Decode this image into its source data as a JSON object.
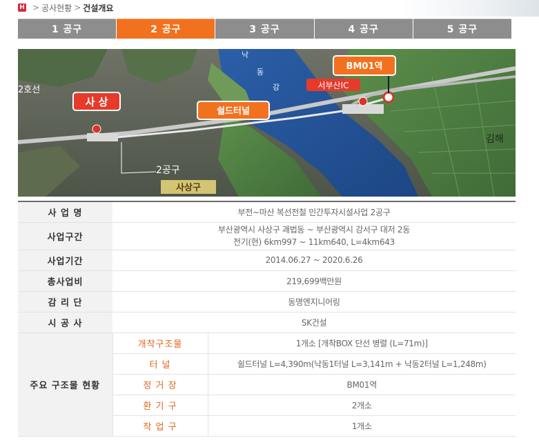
{
  "breadcrumb": {
    "home_glyph": "H",
    "section": "공사현황",
    "current": "건설개요"
  },
  "tabs": [
    {
      "label": "1 공구",
      "active": false
    },
    {
      "label": "2 공구",
      "active": true
    },
    {
      "label": "3 공구",
      "active": false
    },
    {
      "label": "4 공구",
      "active": false
    },
    {
      "label": "5 공구",
      "active": false
    }
  ],
  "map": {
    "labels": {
      "line2": "2호선",
      "sasang": "사 상",
      "shield_tunnel": "쉴드터널",
      "bm01": "BM01역",
      "seobusan_ic": "서부산IC",
      "gimhae": "김해",
      "gongu2": "2공구",
      "sasang_gu": "사상구",
      "river": [
        "낙",
        "동",
        "강"
      ]
    }
  },
  "table": {
    "rows": [
      {
        "label": "사 업 명",
        "value": "부전~마산 복선전철 민간투자시설사업 2공구"
      },
      {
        "label": "사업구간",
        "lines": [
          "부산광역시 사상구 괘법동 ~ 부산광역시 강서구 대저 2동",
          "전기(현) 6km997 ~ 11km640, L=4km643"
        ]
      },
      {
        "label": "사업기간",
        "value": "2014.06.27 ~ 2020.6.26"
      },
      {
        "label": "총사업비",
        "value": "219,699백만원"
      },
      {
        "label": "감 리 단",
        "value": "동명엔지니어링"
      },
      {
        "label": "시 공 사",
        "value": "SK건설"
      }
    ],
    "structures": {
      "label": "주요 구조물 현황",
      "items": [
        {
          "label": "개착구조물",
          "value": "1개소 [개착BOX 단선 병렬 (L=71m)]"
        },
        {
          "label": "터 널",
          "value": "쉴드터널 L=4,390m(낙동1터널 L=3,141m + 낙동2터널 L=1,248m)"
        },
        {
          "label": "정 거 장",
          "value": "BM01역"
        },
        {
          "label": "환 기 구",
          "value": "2개소"
        },
        {
          "label": "작 업 구",
          "value": "1개소"
        }
      ]
    }
  }
}
